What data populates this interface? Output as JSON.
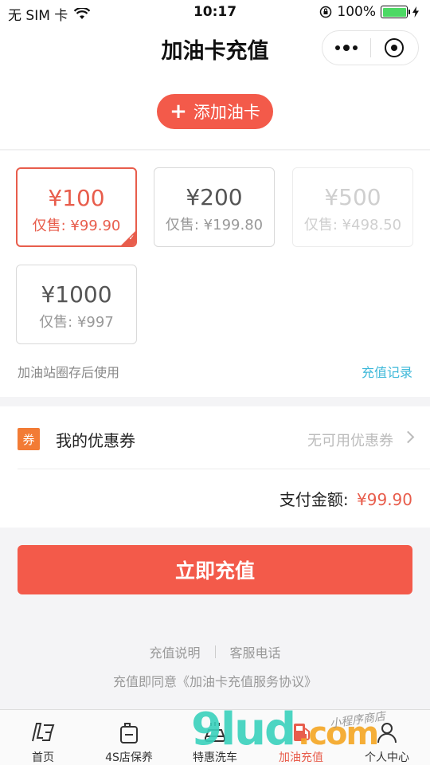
{
  "status_bar": {
    "carrier": "无 SIM 卡",
    "time": "10:17",
    "battery": "100%",
    "battery_level": 1.0
  },
  "nav": {
    "title": "加油卡充值"
  },
  "add_card": {
    "label": "添加油卡"
  },
  "cards": [
    {
      "amount": "¥100",
      "price": "仅售: ¥99.90",
      "state": "selected"
    },
    {
      "amount": "¥200",
      "price": "仅售: ¥199.80",
      "state": "normal"
    },
    {
      "amount": "¥500",
      "price": "仅售: ¥498.50",
      "state": "disabled"
    },
    {
      "amount": "¥1000",
      "price": "仅售: ¥997",
      "state": "normal"
    }
  ],
  "note": "加油站圈存后使用",
  "record_link": "充值记录",
  "coupon": {
    "icon_text": "券",
    "label": "我的优惠券",
    "value": "无可用优惠券"
  },
  "payment": {
    "label": "支付金额:",
    "value": "¥99.90"
  },
  "submit": "立即充值",
  "links": {
    "instructions": "充值说明",
    "service_phone": "客服电话",
    "agreement": "充值即同意《加油卡充值服务协议》"
  },
  "tabs": [
    {
      "label": "首页",
      "icon": "logo-icon"
    },
    {
      "label": "4S店保养",
      "icon": "oil-can-icon"
    },
    {
      "label": "特惠洗车",
      "icon": "car-wash-icon"
    },
    {
      "label": "加油充值",
      "icon": "fuel-pump-icon",
      "active": true
    },
    {
      "label": "个人中心",
      "icon": "user-icon"
    }
  ],
  "watermark": {
    "main": "9lud",
    "suffix": ".com",
    "sub": "小程序商店"
  },
  "colors": {
    "accent": "#f35a4a",
    "link": "#3eb8d9",
    "coupon_icon": "#f27b35"
  }
}
